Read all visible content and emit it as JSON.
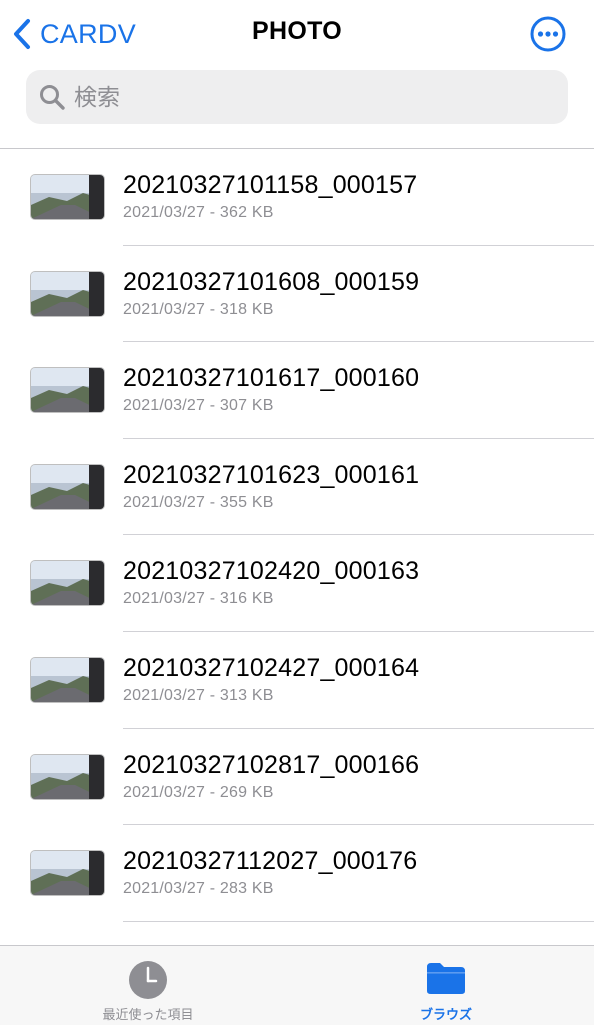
{
  "nav": {
    "back_label": "CARDV",
    "title": "PHOTO",
    "more_icon": "ellipsis-circle-icon"
  },
  "search": {
    "placeholder": "検索",
    "value": ""
  },
  "files": [
    {
      "name": "20210327101158_000157",
      "meta": "2021/03/27 - 362 KB"
    },
    {
      "name": "20210327101608_000159",
      "meta": "2021/03/27 - 318 KB"
    },
    {
      "name": "20210327101617_000160",
      "meta": "2021/03/27 - 307 KB"
    },
    {
      "name": "20210327101623_000161",
      "meta": "2021/03/27 - 355 KB"
    },
    {
      "name": "20210327102420_000163",
      "meta": "2021/03/27 - 316 KB"
    },
    {
      "name": "20210327102427_000164",
      "meta": "2021/03/27 - 313 KB"
    },
    {
      "name": "20210327102817_000166",
      "meta": "2021/03/27 - 269 KB"
    },
    {
      "name": "20210327112027_000176",
      "meta": "2021/03/27 - 283 KB"
    }
  ],
  "tabbar": {
    "recent_label": "最近使った項目",
    "browse_label": "ブラウズ",
    "selected": "browse"
  },
  "colors": {
    "accent": "#1a73e8",
    "secondary_text": "#8e8e93",
    "search_bg": "#eeeeef"
  }
}
